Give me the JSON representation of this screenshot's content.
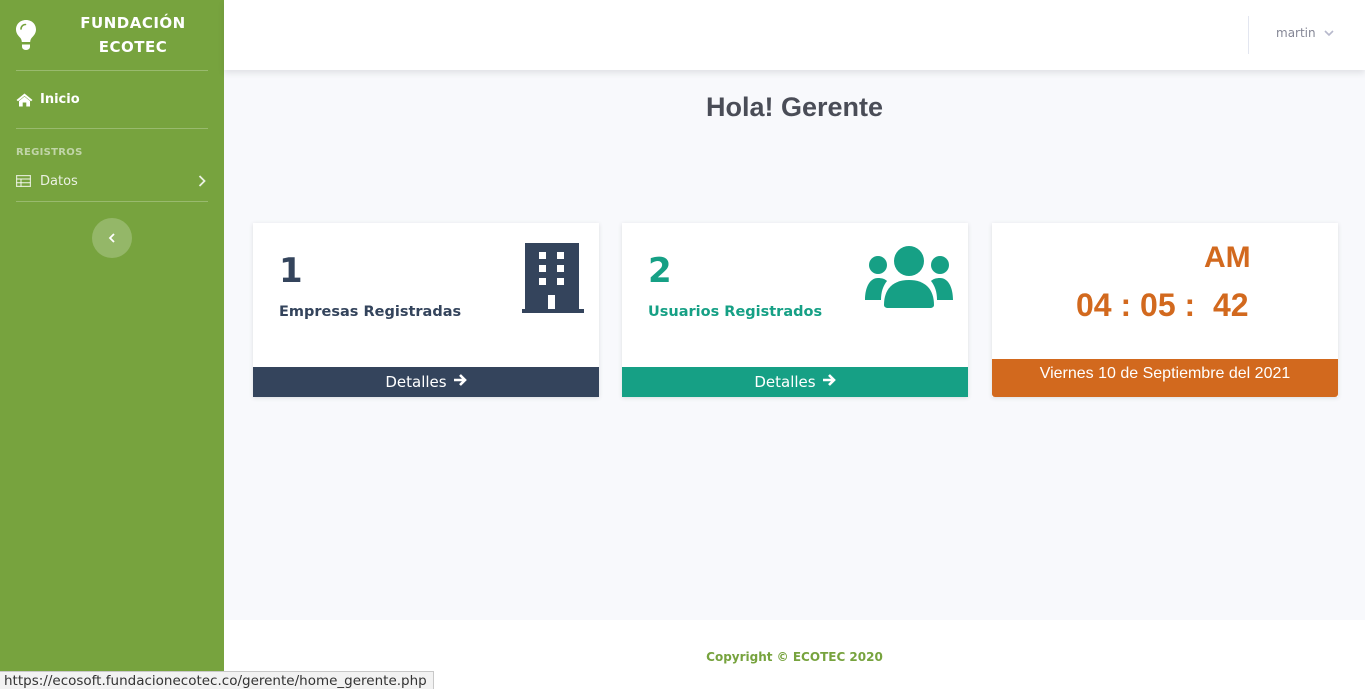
{
  "sidebar": {
    "brand_line1": "FUNDACIÓN",
    "brand_line2": "ECOTEC",
    "brand_icon": "lightbulb-icon",
    "inicio_label": "Inicio",
    "section_heading": "REGISTROS",
    "datos_label": "Datos"
  },
  "topbar": {
    "username": "martin"
  },
  "main": {
    "greeting": "Hola! Gerente",
    "cards": [
      {
        "count": "1",
        "label": "Empresas Registradas",
        "footer": "Detalles",
        "icon": "building-icon",
        "color": "#34445c"
      },
      {
        "count": "2",
        "label": "Usuarios Registrados",
        "footer": "Detalles",
        "icon": "users-icon",
        "color": "#16a085"
      }
    ],
    "clock": {
      "ampm": "AM",
      "time": "04 : 05 :  42",
      "date": "Viernes 10 de Septiembre del 2021",
      "color": "#d2691e"
    }
  },
  "footer": {
    "copyright": "Copyright © ECOTEC 2020"
  },
  "status_bar": {
    "url": "https://ecosoft.fundacionecotec.co/gerente/home_gerente.php"
  },
  "colors": {
    "sidebar": "#77a33e",
    "background": "#f8f9fc"
  }
}
